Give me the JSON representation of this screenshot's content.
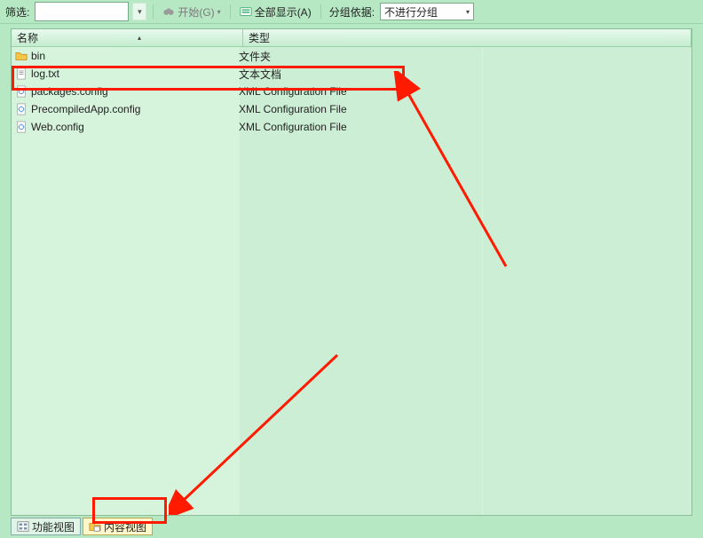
{
  "toolbar": {
    "filter_label": "筛选:",
    "filter_value": "",
    "start_label": "开始(G)",
    "show_all_label": "全部显示(A)",
    "group_by_label": "分组依据:",
    "group_by_value": "不进行分组"
  },
  "columns": {
    "name": "名称",
    "type": "类型"
  },
  "rows": [
    {
      "icon": "folder-icon",
      "name": "bin",
      "type": "文件夹"
    },
    {
      "icon": "text-file-icon",
      "name": "log.txt",
      "type": "文本文档"
    },
    {
      "icon": "config-file-icon",
      "name": "packages.config",
      "type": "XML Configuration File"
    },
    {
      "icon": "config-file-icon",
      "name": "PrecompiledApp.config",
      "type": "XML Configuration File"
    },
    {
      "icon": "config-file-icon",
      "name": "Web.config",
      "type": "XML Configuration File"
    }
  ],
  "tabs": {
    "features": "功能视图",
    "content": "内容视图"
  }
}
